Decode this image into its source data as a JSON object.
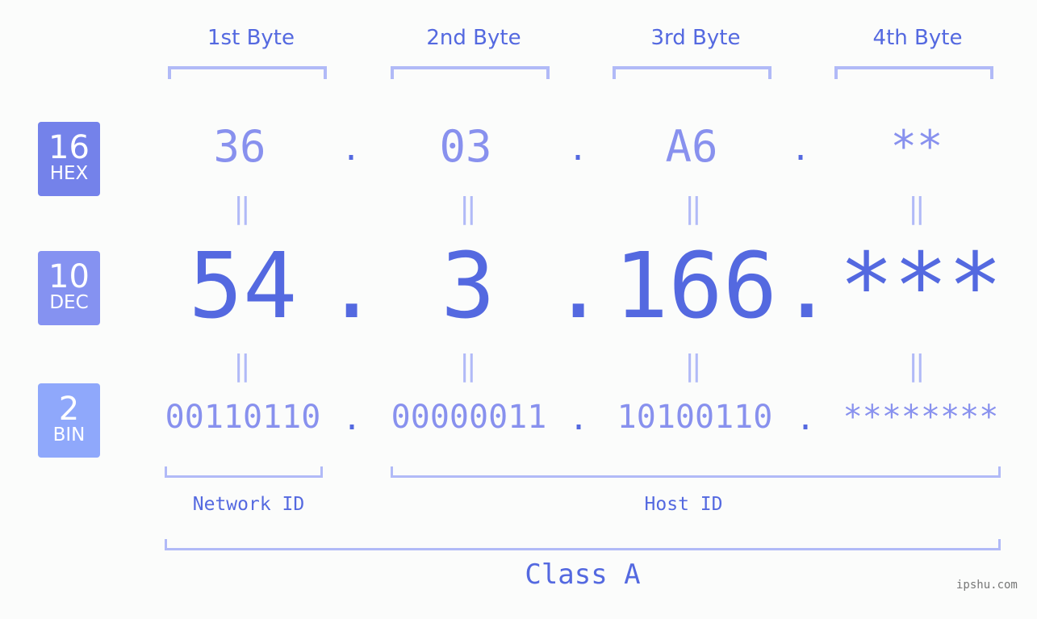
{
  "badges": [
    {
      "number": "16",
      "label": "HEX",
      "color": "#7482ea"
    },
    {
      "number": "10",
      "label": "DEC",
      "color": "#8592f1"
    },
    {
      "number": "2",
      "label": "BIN",
      "color": "#8fa8fb"
    }
  ],
  "bytes": [
    {
      "header": "1st Byte",
      "hex": "36",
      "dec": "54",
      "bin": "00110110"
    },
    {
      "header": "2nd Byte",
      "hex": "03",
      "dec": "3",
      "bin": "00000011"
    },
    {
      "header": "3rd Byte",
      "hex": "A6",
      "dec": "166",
      "bin": "10100110"
    },
    {
      "header": "4th Byte",
      "hex": "**",
      "dec": "***",
      "bin": "********"
    }
  ],
  "separator": ".",
  "equals": "=",
  "network_label": "Network ID",
  "host_label": "Host ID",
  "class_label": "Class A",
  "watermark": "ipshu.com",
  "colors": {
    "accent": "#5469e0",
    "light": "#8891ee",
    "bracket": "#b1baf7"
  }
}
